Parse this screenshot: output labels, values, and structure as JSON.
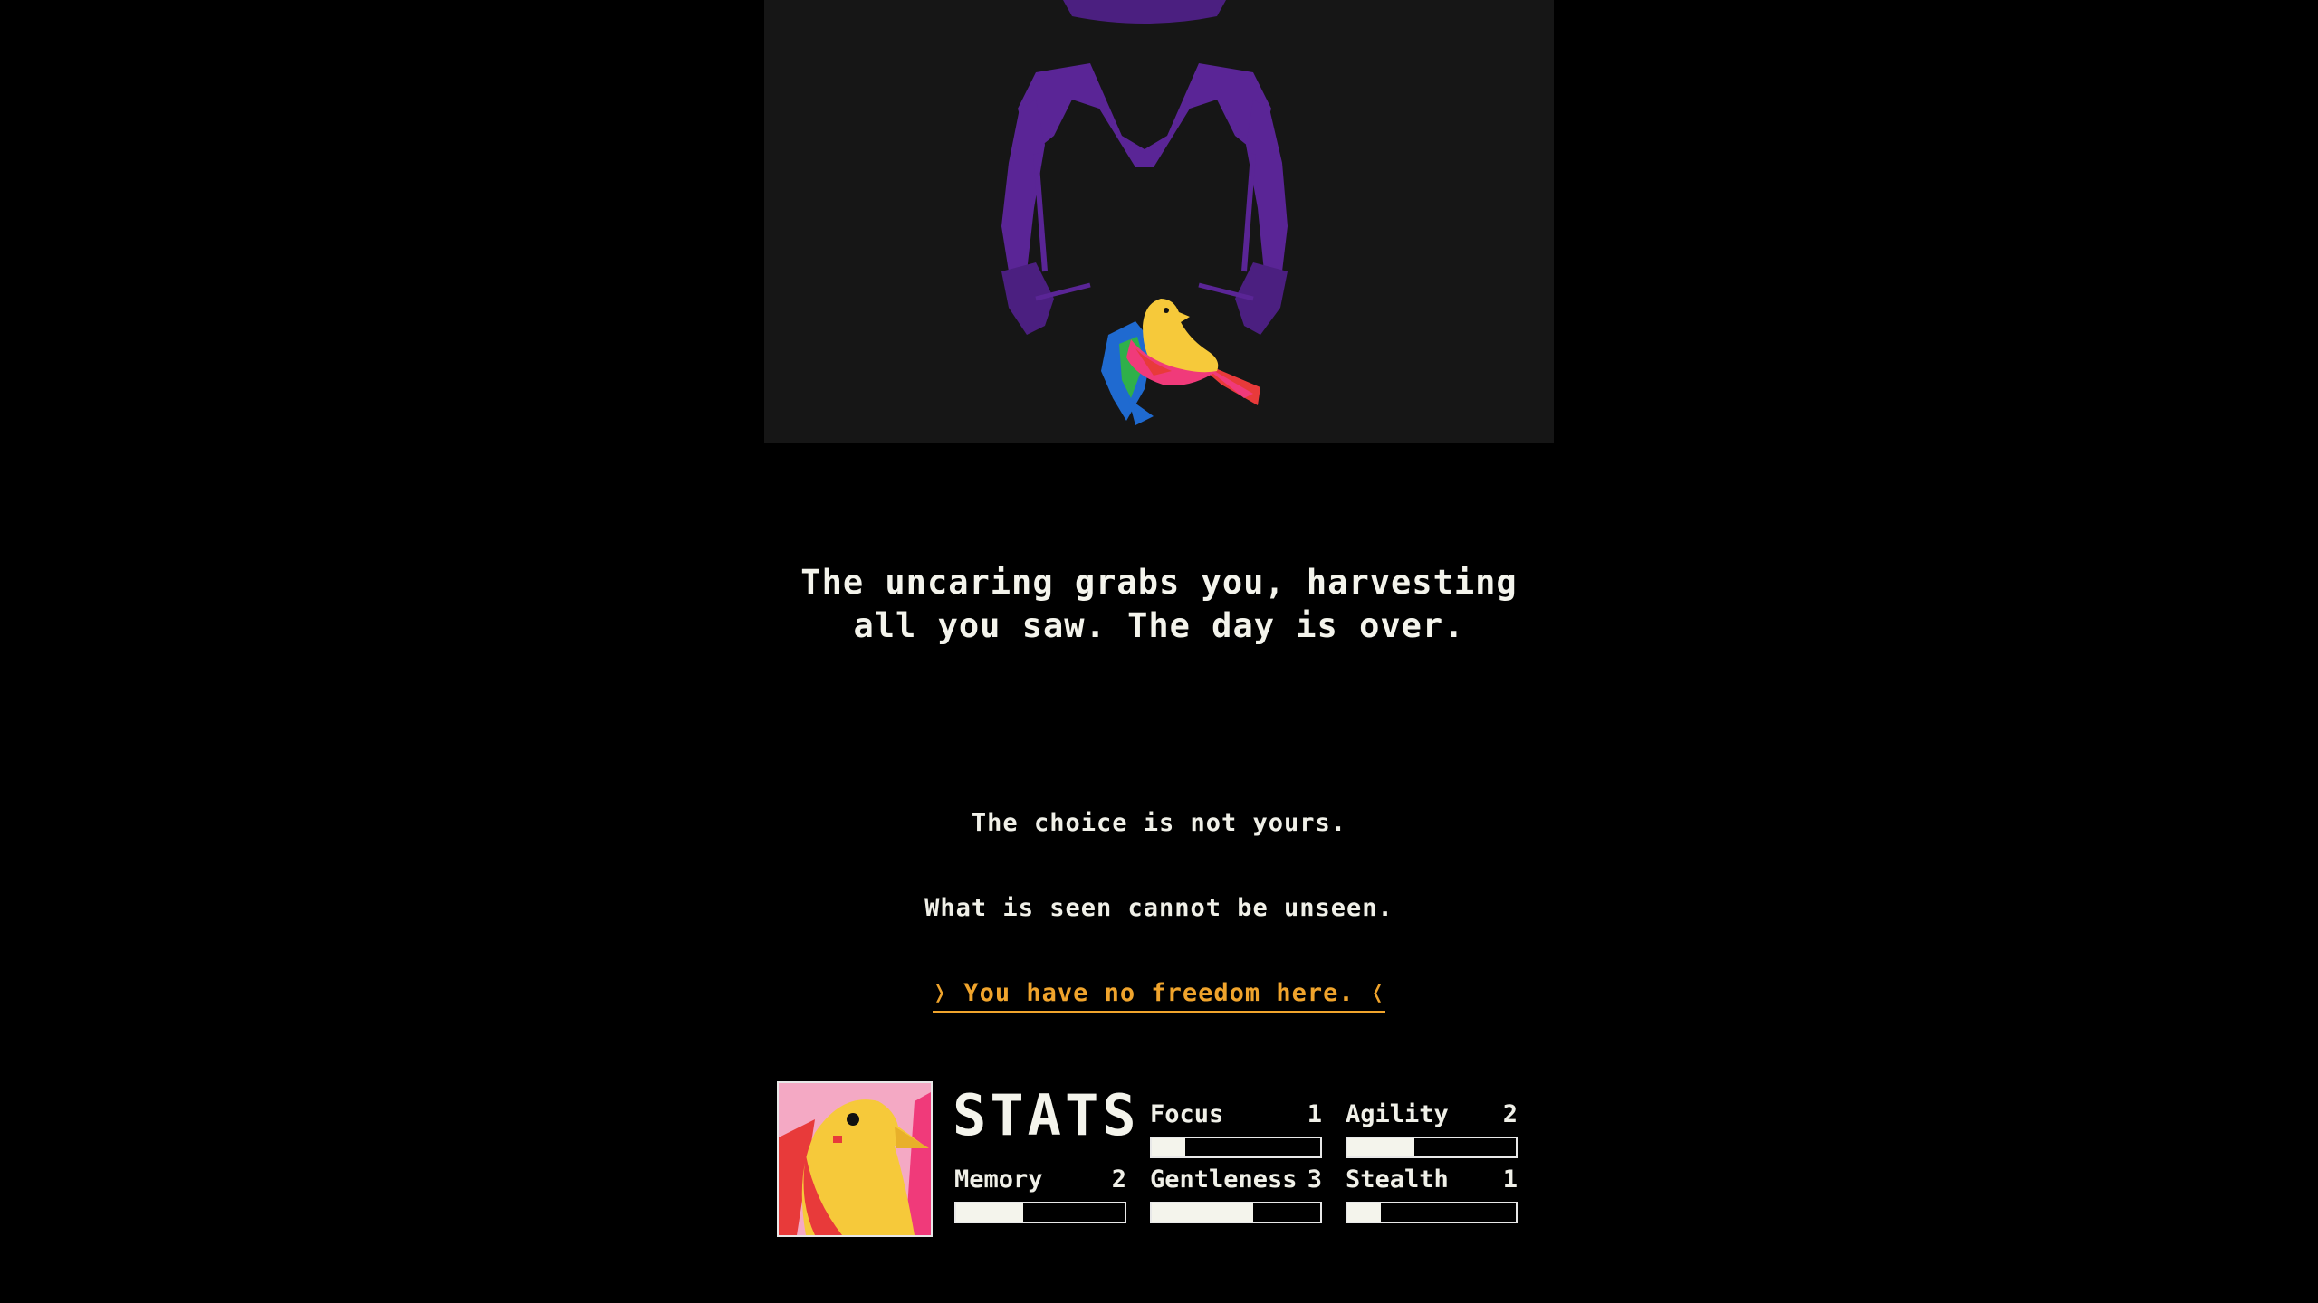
{
  "scene": {
    "illustration": "figure-in-hat-holding-canary",
    "colors": {
      "background": "#161616",
      "figure": "#5a2596",
      "bird_body": "#f6c93a",
      "bird_wing": "#f03a7a",
      "bird_tail": "#e83a3a",
      "hands": "#1f6ad0",
      "hands_accent": "#2fb04a"
    }
  },
  "narrative": {
    "text": "The uncaring grabs you, harvesting all you saw. The day is over."
  },
  "choices": {
    "note_1": "The choice is not yours.",
    "note_2": "What is seen cannot be unseen.",
    "link": "❭ You have no freedom here. ❬",
    "link_color": "#f0a42c"
  },
  "stats": {
    "title": "STATS",
    "portrait": "canary-portrait",
    "items": {
      "focus": {
        "label": "Focus",
        "value": "1",
        "fill": 0.2
      },
      "agility": {
        "label": "Agility",
        "value": "2",
        "fill": 0.4
      },
      "memory": {
        "label": "Memory",
        "value": "2",
        "fill": 0.4
      },
      "gentleness": {
        "label": "Gentleness",
        "value": "3",
        "fill": 0.6
      },
      "stealth": {
        "label": "Stealth",
        "value": "1",
        "fill": 0.2
      }
    }
  }
}
